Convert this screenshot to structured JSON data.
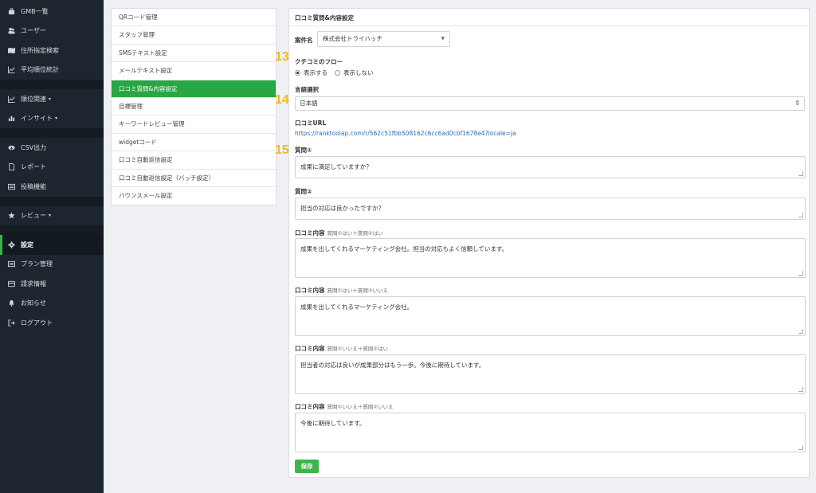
{
  "sidebar": {
    "items": [
      {
        "label": "GMB一覧",
        "icon": "briefcase-icon"
      },
      {
        "label": "ユーザー",
        "icon": "users-icon"
      },
      {
        "label": "住所指定検索",
        "icon": "map-icon"
      },
      {
        "label": "平均順位統計",
        "icon": "line-chart-icon"
      },
      {
        "label": "順位関連",
        "icon": "line-chart-icon",
        "caret": "▾"
      },
      {
        "label": "インサイト",
        "icon": "bar-chart-icon",
        "caret": "▾"
      },
      {
        "label": "CSV出力",
        "icon": "cloud-download-icon"
      },
      {
        "label": "レポート",
        "icon": "document-icon"
      },
      {
        "label": "投稿機能",
        "icon": "list-icon"
      },
      {
        "label": "レビュー",
        "icon": "star-icon",
        "caret": "▾"
      },
      {
        "label": "設定",
        "icon": "gear-icon"
      },
      {
        "label": "プラン管理",
        "icon": "list-icon"
      },
      {
        "label": "請求情報",
        "icon": "credit-card-icon"
      },
      {
        "label": "お知らせ",
        "icon": "bell-icon"
      },
      {
        "label": "ログアウト",
        "icon": "logout-icon"
      }
    ]
  },
  "submenu": {
    "items": [
      "QRコード管理",
      "スタッフ管理",
      "SMSテキスト設定",
      "メールテキスト設定",
      "口コミ質問&内容設定",
      "目標管理",
      "キーワードレビュー管理",
      "widgetコード",
      "口コミ自動返信設定",
      "口コミ自動返信設定（バッチ設定）",
      "バウンスメール設定"
    ]
  },
  "panel": {
    "title": "口コミ質問&内容設定",
    "case_label": "案件名",
    "case_value": "株式会社トライハッチ",
    "flow_label": "クチコミのフロー",
    "flow_show": "表示する",
    "flow_hide": "表示しない",
    "lang_label": "言語選択",
    "lang_value": "日本語",
    "url_label": "口コミURL",
    "url_value": "https://ranktoolap.com/r/562c51fbb508162c6cc6ad0cbf1678e4?locale=ja",
    "q1_label": "質問①",
    "q1_value": "成果に満足していますか？",
    "q2_label": "質問②",
    "q2_value": "担当の対応は良かったですか？",
    "review_label": "口コミ内容",
    "reviews": [
      {
        "cond": "質問①はい＋質問②はい",
        "text": "成果を出してくれるマーケティング会社。担当の対応もよく信頼しています。"
      },
      {
        "cond": "質問①はい＋質問②いいえ",
        "text": "成果を出してくれるマーケティング会社。"
      },
      {
        "cond": "質問①いいえ＋質問②はい",
        "text": "担当者の対応は良いが成果部分はもう一歩。今後に期待しています。"
      },
      {
        "cond": "質問①いいえ＋質問②いいえ",
        "text": "今後に期待しています。"
      }
    ],
    "save_label": "保存"
  },
  "markers": {
    "m13": "13",
    "m14": "14",
    "m15": "15"
  },
  "colors": {
    "sidebar_bg": "#1d262e",
    "accent": "#28a745",
    "link": "#2a6fb5",
    "marker": "#f4b915"
  }
}
